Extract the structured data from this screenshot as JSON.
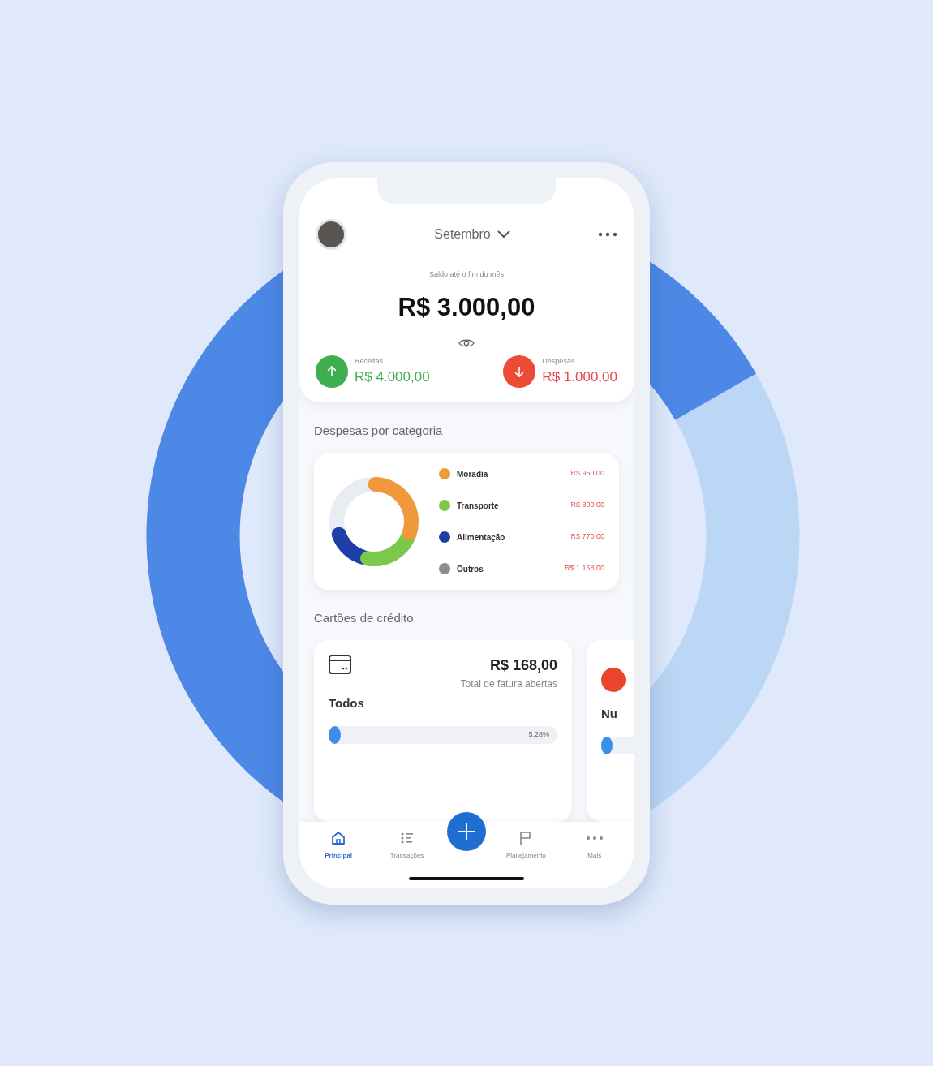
{
  "header": {
    "month": "Setembro",
    "balance_label": "Saldo até o fim do mês",
    "balance": "R$ 3.000,00"
  },
  "summary": [
    {
      "kind": "income",
      "label": "Receitas",
      "amount": "R$ 4.000,00"
    },
    {
      "kind": "expense",
      "label": "Despesas",
      "amount": "R$ 1.000,00"
    }
  ],
  "expenses_section": {
    "title": "Despesas por categoria",
    "legend": [
      {
        "label": "Moradia",
        "amount": "R$ 950,00",
        "color": "#f0983a"
      },
      {
        "label": "Transporte",
        "amount": "R$ 800,00",
        "color": "#7cc84a"
      },
      {
        "label": "Alimentação",
        "amount": "R$ 770,00",
        "color": "#1e3fa8"
      },
      {
        "label": "Outros",
        "amount": "R$ 1.158,00",
        "color": "#8a8d92"
      }
    ]
  },
  "cards_section": {
    "title": "Cartões de crédito",
    "cards": [
      {
        "kind": "all",
        "name": "Todos",
        "amount": "R$ 168,00",
        "caption": "Total de fatura abertas",
        "level": 0.0528,
        "reading": "5.28%"
      },
      {
        "kind": "bank",
        "name": "Nu"
      }
    ]
  },
  "nav": [
    {
      "kind": "home",
      "label": "Principal",
      "selected": true
    },
    {
      "kind": "list",
      "label": "Transações",
      "selected": false
    },
    {
      "kind": "flag",
      "label": "Planejamento",
      "selected": false
    },
    {
      "kind": "more",
      "label": "Mais",
      "selected": false
    }
  ]
}
